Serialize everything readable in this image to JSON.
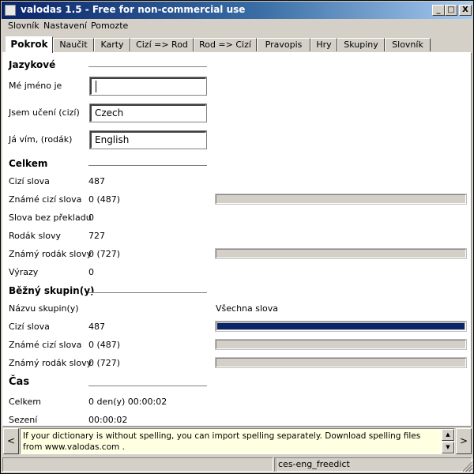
{
  "window": {
    "title": "valodas 1.5 - Free for non-commercial use",
    "controls": {
      "minimize": "_",
      "maximize": "□",
      "close": "X"
    }
  },
  "menu": [
    "Slovník",
    "Nastavení",
    "Pomozte"
  ],
  "tabs": [
    "Pokrok",
    "Naučit",
    "Karty",
    "Cizí => Rod",
    "Rod => Cizí",
    "Pravopis",
    "Hry",
    "Skupiny",
    "Slovník"
  ],
  "active_tab": "Pokrok",
  "language": {
    "heading": "Jazykové",
    "name_label": "Mé jméno je",
    "name_value": "",
    "learning_label": "Jsem učení (cizí)",
    "learning_value": "Czech",
    "know_label": "Já vím, (rodák)",
    "know_value": "English"
  },
  "totals": {
    "heading": "Celkem",
    "rows": [
      {
        "label": "Cizí slova",
        "value": "487"
      },
      {
        "label": "Známé cizí slova",
        "value": "0 (487)",
        "progress": 0
      },
      {
        "label": "Slova bez překladu",
        "value": "0"
      },
      {
        "label": "Rodák slovy",
        "value": "727"
      },
      {
        "label": "Známý rodák slovy",
        "value": "0 (727)",
        "progress": 0
      },
      {
        "label": "Výrazy",
        "value": "0"
      }
    ]
  },
  "groups": {
    "heading": "Běžný skupin(y)",
    "name_label": "Názvu skupin(y)",
    "name_value": "Všechna slova",
    "rows": [
      {
        "label": "Cizí slova",
        "value": "487",
        "progress": 1.0
      },
      {
        "label": "Známé cizí slova",
        "value": "0 (487)",
        "progress": 0
      },
      {
        "label": "Známý rodák slovy",
        "value": "0 (727)",
        "progress": 0
      }
    ]
  },
  "time": {
    "heading": "Čas",
    "total_label": "Celkem",
    "total_value": "0 den(y) 00:00:02",
    "session_label": "Sezení",
    "session_value": "00:00:02"
  },
  "hint": {
    "prev": "<",
    "next": ">",
    "text": "If your dictionary is without spelling, you can import spelling separately. Download spelling files from www.valodas.com ."
  },
  "status": {
    "left": "",
    "middle": "",
    "dictionary": "ces-eng_freedict"
  },
  "colors": {
    "progress_fill": "#0a246a",
    "hint_bg": "#ffffe1",
    "titlebar": "#0a246a"
  }
}
